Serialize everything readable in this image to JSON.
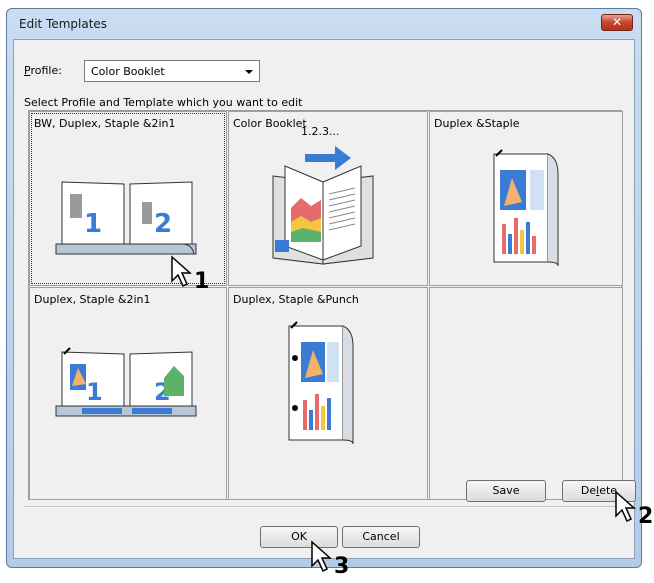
{
  "window": {
    "title": "Edit Templates",
    "close_label": "✕"
  },
  "profile": {
    "label_prefix": "P",
    "label_rest": "rofile:",
    "value": "Color Booklet"
  },
  "instruction": "Select Profile and Template which you want to edit",
  "templates": [
    {
      "label": "BW, Duplex, Staple &2in1",
      "selected": true
    },
    {
      "label": "Color Booklet",
      "overlay": "1.2.3..."
    },
    {
      "label": "Duplex &Staple"
    },
    {
      "label": "Duplex, Staple &2in1"
    },
    {
      "label": "Duplex, Staple &Punch"
    },
    {
      "label": ""
    }
  ],
  "buttons": {
    "save": "Save",
    "delete_pre": "De",
    "delete_u": "l",
    "delete_post": "ete",
    "ok": "OK",
    "cancel": "Cancel"
  },
  "callouts": [
    "1",
    "2",
    "3"
  ]
}
